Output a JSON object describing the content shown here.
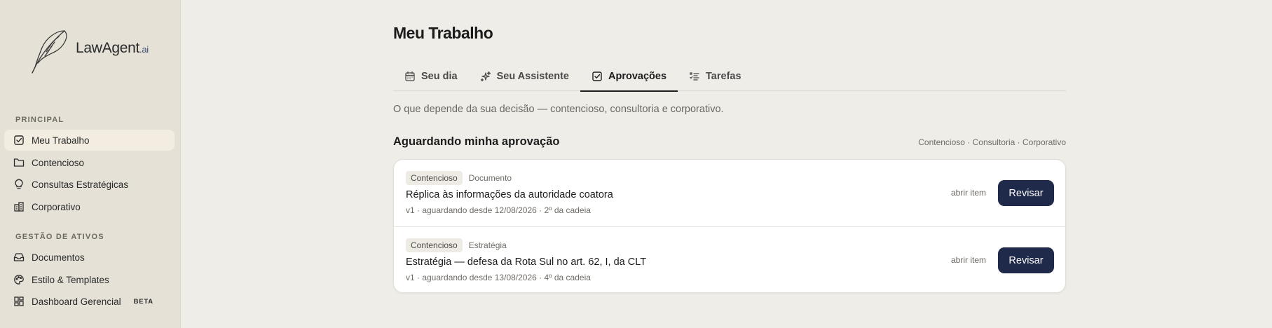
{
  "brand": {
    "name": "LawAgent",
    "suffix": ".ai"
  },
  "sidebar": {
    "sections": [
      {
        "label": "PRINCIPAL"
      },
      {
        "label": "GESTÃO DE ATIVOS"
      }
    ],
    "items": [
      {
        "label": "Meu Trabalho",
        "icon": "check-square-icon"
      },
      {
        "label": "Contencioso",
        "icon": "folder-icon"
      },
      {
        "label": "Consultas Estratégicas",
        "icon": "lightbulb-icon"
      },
      {
        "label": "Corporativo",
        "icon": "building-icon"
      },
      {
        "label": "Documentos",
        "icon": "inbox-icon"
      },
      {
        "label": "Estilo & Templates",
        "icon": "palette-icon"
      },
      {
        "label": "Dashboard Gerencial",
        "icon": "dashboard-icon",
        "badge": "BETA"
      }
    ]
  },
  "main": {
    "title": "Meu Trabalho",
    "tabs": [
      {
        "label": "Seu dia",
        "icon": "calendar-icon"
      },
      {
        "label": "Seu Assistente",
        "icon": "sparkles-icon"
      },
      {
        "label": "Aprovações",
        "icon": "check-square-icon"
      },
      {
        "label": "Tarefas",
        "icon": "list-checks-icon"
      }
    ],
    "subtitle": "O que depende da sua decisão — contencioso, consultoria e corporativo.",
    "section_title": "Aguardando minha aprovação",
    "section_filters": "Contencioso · Consultoria · Corporativo",
    "items": [
      {
        "tag": "Contencioso",
        "kind": "Documento",
        "title": "Réplica às informações da autoridade coatora",
        "meta": "v1 · aguardando desde 12/08/2026 · 2º da cadeia",
        "open_label": "abrir item",
        "button_label": "Revisar"
      },
      {
        "tag": "Contencioso",
        "kind": "Estratégia",
        "title": "Estratégia — defesa da Rota Sul no art. 62, I, da CLT",
        "meta": "v1 · aguardando desde 13/08/2026 · 4º da cadeia",
        "open_label": "abrir item",
        "button_label": "Revisar"
      }
    ]
  },
  "colors": {
    "accent": "#1f2a4a",
    "sidebar_bg": "#e5e1d7",
    "page_bg": "#efede8",
    "active_nav": "#f2ede0"
  }
}
